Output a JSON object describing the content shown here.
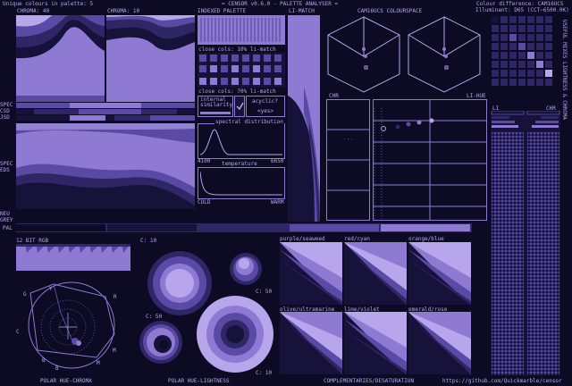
{
  "header": {
    "unique_colours": "Unique colours in palette: 5",
    "title": "= CENSOR v0.6.0 - PALETTE ANALYSER =",
    "colour_difference": "Colour difference: CAM16UCS",
    "illuminant": "Illuminant: D65 (CCT~6500.0K)"
  },
  "top_labels": {
    "chroma_40": "CHROMA: 40",
    "chroma_10": "CHROMA: 10",
    "indexed_palette": "INDEXED PALETTE",
    "li_match": "LI-MATCH",
    "colourspace": "CAM16UCS COLOURSPACE"
  },
  "side_labels": {
    "spec": "SPEC",
    "csd": "CSD",
    "jsd": "JSD",
    "spec2": "SPEC",
    "eds": "EDS",
    "neu": "NEU",
    "grey": "GREY",
    "pal": "PAL"
  },
  "palette_panel": {
    "close_cols_10": "close cols: 10% li-match",
    "close_cols_70": "close cols: 70% li-match",
    "internal_similarity": "internal similarity",
    "cycle_question": "acyclic?",
    "cycle_answer": "<yes>",
    "spectral_distribution": "spectral distribution",
    "spec_min": "4100",
    "spec_max": "6650",
    "temperature": "temperature",
    "cold": "COLD",
    "warm": "WARM"
  },
  "cam_panel": {
    "chr": "CHR",
    "li_hue": "LI-HUE"
  },
  "right_panel": {
    "li": "LI",
    "chr": "CHR",
    "vertical_label": "USEFUL MIXES   LIGHTNESS & CHROMA"
  },
  "bottom_labels": {
    "bit_rgb": "12 BIT RGB",
    "c10_a": "C: 10",
    "c50_a": "C: 50",
    "c50_b": "C: 50",
    "c10_b": "C: 10",
    "polar_hue_chroma": "POLAR HUE-CHROMA",
    "polar_hue_lightness": "POLAR HUE-LIGHTNESS",
    "complementaries": "COMPLEMENTARIES/DESATURATION",
    "github": "https://github.com/Quickmarble/censor"
  },
  "polar_letters": {
    "g": "G",
    "y": "Y",
    "r": "R",
    "c": "C",
    "m": "M",
    "b": "B",
    "b2": "B",
    "m2": "M"
  },
  "complementaries": [
    {
      "label": "purple/seaweed"
    },
    {
      "label": "red/cyan"
    },
    {
      "label": "orange/blue"
    },
    {
      "label": "olive/ultramarine"
    },
    {
      "label": "lime/violet"
    },
    {
      "label": "emerald/rose"
    }
  ],
  "colors": {
    "bg": "#0d0a24",
    "c1": "#16123a",
    "c2": "#2e2665",
    "c3": "#5a4aa6",
    "c4": "#8f7ad3",
    "c5": "#b8a6ec"
  }
}
